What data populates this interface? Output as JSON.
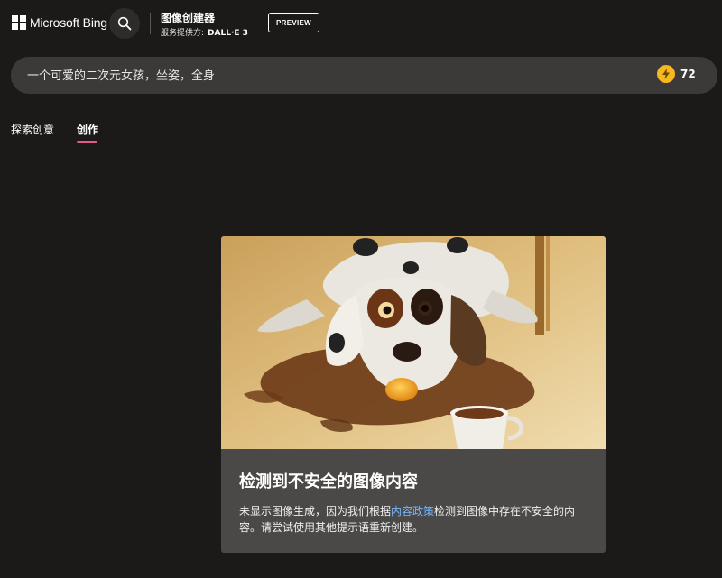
{
  "header": {
    "brand_name": "Microsoft Bing",
    "app_title": "图像创建器",
    "provider_label": "服务提供方:",
    "provider_name": "DALL·E 3",
    "preview_badge": "PREVIEW"
  },
  "prompt": {
    "value": "一个可爱的二次元女孩，坐姿，全身"
  },
  "boosts": {
    "count": "72"
  },
  "tabs": [
    {
      "label": "探索创意",
      "active": false
    },
    {
      "label": "创作",
      "active": true
    }
  ],
  "result_card": {
    "title": "检测到不安全的图像内容",
    "body_prefix": "未显示图像生成，因为我们根据",
    "policy_link": "内容政策",
    "body_suffix": "检测到图像中存在不安全的内容。请尝试使用其他提示语重新创建。"
  },
  "colors": {
    "background": "#1b1a19",
    "prompt_bar": "#3b3a39",
    "card": "#4a4948",
    "active_tab_underline": "#e8578d",
    "link": "#77b7ff",
    "boost_coin": "#f5b91f"
  },
  "icons": {
    "search": "search-icon",
    "boost": "lightning-icon",
    "logo": "microsoft-logo-icon"
  }
}
